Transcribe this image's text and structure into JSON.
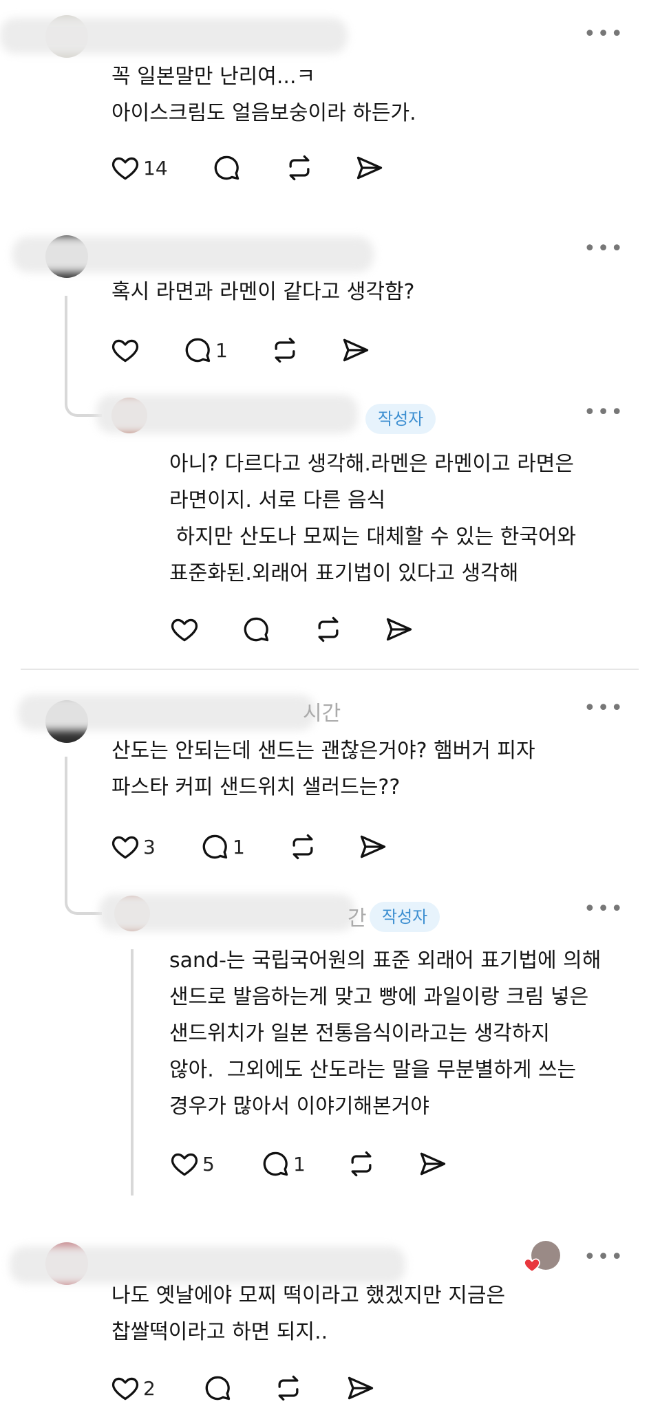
{
  "more_label": "•••",
  "author_badge": "작성자",
  "comments": [
    {
      "text": "꼭 일본말만 난리여...ㅋ\n아이스크림도 얼음보숭이라 하든가.",
      "likes": "14",
      "replies": ""
    },
    {
      "text": "혹시 라면과 라멘이 같다고 생각함?",
      "likes": "",
      "replies": "1"
    },
    {
      "text": "아니? 다르다고 생각해.라멘은 라멘이고 라면은\n라면이지. 서로 다른 음식\n 하지만 산도나 모찌는 대체할 수 있는 한국어와\n표준화된.외래어 표기법이 있다고 생각해",
      "likes": "",
      "replies": ""
    },
    {
      "text": "산도는 안되는데 샌드는 괜찮은거야? 햄버거 피자\n파스타 커피 샌드위치 샐러드는??",
      "likes": "3",
      "replies": "1"
    },
    {
      "text": "sand-는 국립국어원의 표준 외래어 표기법에 의해\n샌드로 발음하는게 맞고 빵에 과일이랑 크림 넣은\n샌드위치가 일본 전통음식이라고는 생각하지\n않아.  그외에도 산도라는 말을 무분별하게 쓰는\n경우가 많아서 이야기해본거야",
      "likes": "5",
      "replies": "1"
    },
    {
      "text": "나도 옛날에야 모찌 떡이라고 했겠지만 지금은\n찹쌀떡이라고 하면 되지..",
      "likes": "2",
      "replies": ""
    }
  ],
  "partial_texts": {
    "time_fragment_1": "시간",
    "time_fragment_2": "간"
  },
  "colors": {
    "like_heart": "#e8373e",
    "badge_bg": "#e7f3fc",
    "badge_text": "#3d8fd1"
  }
}
